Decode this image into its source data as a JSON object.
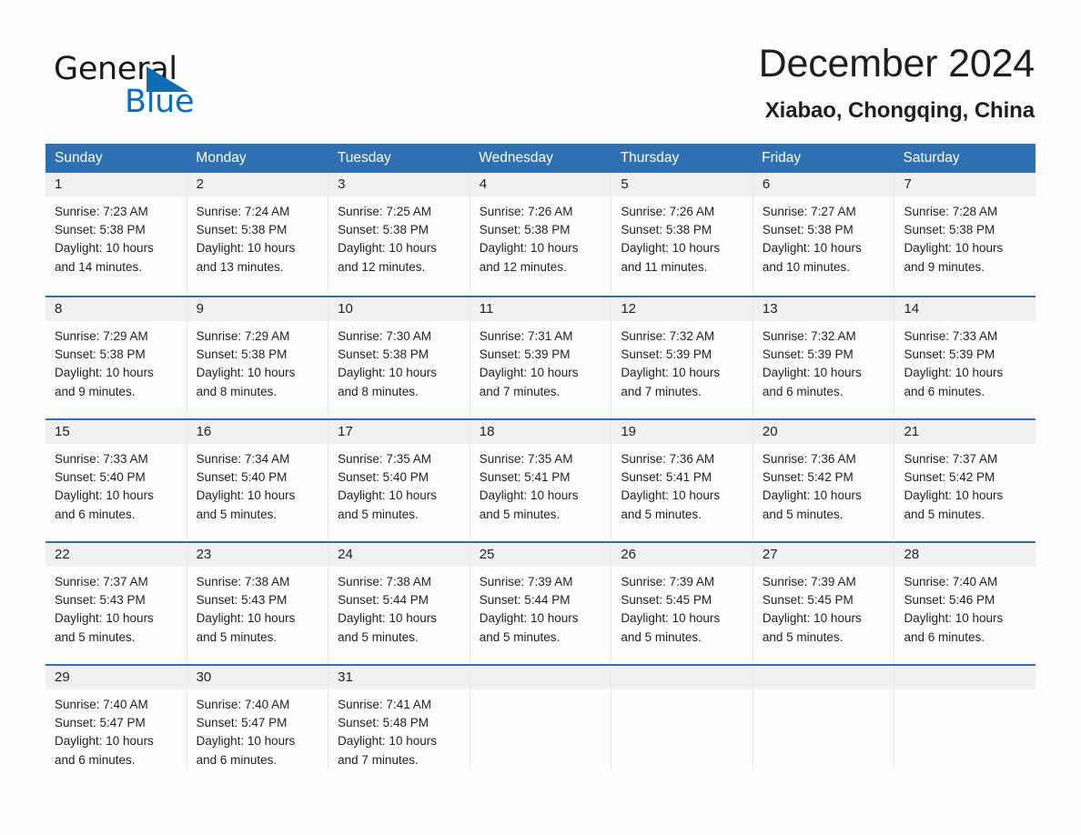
{
  "brand": {
    "name_part1": "General",
    "name_part2": "Blue"
  },
  "header": {
    "title": "December 2024",
    "location": "Xiabao, Chongqing, China"
  },
  "colors": {
    "header_blue": "#2e70b2",
    "brand_blue": "#0b6ec4",
    "daynum_band": "#f0f0f0",
    "text": "#1f1f1f"
  },
  "weekdays": [
    "Sunday",
    "Monday",
    "Tuesday",
    "Wednesday",
    "Thursday",
    "Friday",
    "Saturday"
  ],
  "weeks": [
    [
      {
        "day": "1",
        "lines": [
          "Sunrise: 7:23 AM",
          "Sunset: 5:38 PM",
          "Daylight: 10 hours",
          "and 14 minutes."
        ]
      },
      {
        "day": "2",
        "lines": [
          "Sunrise: 7:24 AM",
          "Sunset: 5:38 PM",
          "Daylight: 10 hours",
          "and 13 minutes."
        ]
      },
      {
        "day": "3",
        "lines": [
          "Sunrise: 7:25 AM",
          "Sunset: 5:38 PM",
          "Daylight: 10 hours",
          "and 12 minutes."
        ]
      },
      {
        "day": "4",
        "lines": [
          "Sunrise: 7:26 AM",
          "Sunset: 5:38 PM",
          "Daylight: 10 hours",
          "and 12 minutes."
        ]
      },
      {
        "day": "5",
        "lines": [
          "Sunrise: 7:26 AM",
          "Sunset: 5:38 PM",
          "Daylight: 10 hours",
          "and 11 minutes."
        ]
      },
      {
        "day": "6",
        "lines": [
          "Sunrise: 7:27 AM",
          "Sunset: 5:38 PM",
          "Daylight: 10 hours",
          "and 10 minutes."
        ]
      },
      {
        "day": "7",
        "lines": [
          "Sunrise: 7:28 AM",
          "Sunset: 5:38 PM",
          "Daylight: 10 hours",
          "and 9 minutes."
        ]
      }
    ],
    [
      {
        "day": "8",
        "lines": [
          "Sunrise: 7:29 AM",
          "Sunset: 5:38 PM",
          "Daylight: 10 hours",
          "and 9 minutes."
        ]
      },
      {
        "day": "9",
        "lines": [
          "Sunrise: 7:29 AM",
          "Sunset: 5:38 PM",
          "Daylight: 10 hours",
          "and 8 minutes."
        ]
      },
      {
        "day": "10",
        "lines": [
          "Sunrise: 7:30 AM",
          "Sunset: 5:38 PM",
          "Daylight: 10 hours",
          "and 8 minutes."
        ]
      },
      {
        "day": "11",
        "lines": [
          "Sunrise: 7:31 AM",
          "Sunset: 5:39 PM",
          "Daylight: 10 hours",
          "and 7 minutes."
        ]
      },
      {
        "day": "12",
        "lines": [
          "Sunrise: 7:32 AM",
          "Sunset: 5:39 PM",
          "Daylight: 10 hours",
          "and 7 minutes."
        ]
      },
      {
        "day": "13",
        "lines": [
          "Sunrise: 7:32 AM",
          "Sunset: 5:39 PM",
          "Daylight: 10 hours",
          "and 6 minutes."
        ]
      },
      {
        "day": "14",
        "lines": [
          "Sunrise: 7:33 AM",
          "Sunset: 5:39 PM",
          "Daylight: 10 hours",
          "and 6 minutes."
        ]
      }
    ],
    [
      {
        "day": "15",
        "lines": [
          "Sunrise: 7:33 AM",
          "Sunset: 5:40 PM",
          "Daylight: 10 hours",
          "and 6 minutes."
        ]
      },
      {
        "day": "16",
        "lines": [
          "Sunrise: 7:34 AM",
          "Sunset: 5:40 PM",
          "Daylight: 10 hours",
          "and 5 minutes."
        ]
      },
      {
        "day": "17",
        "lines": [
          "Sunrise: 7:35 AM",
          "Sunset: 5:40 PM",
          "Daylight: 10 hours",
          "and 5 minutes."
        ]
      },
      {
        "day": "18",
        "lines": [
          "Sunrise: 7:35 AM",
          "Sunset: 5:41 PM",
          "Daylight: 10 hours",
          "and 5 minutes."
        ]
      },
      {
        "day": "19",
        "lines": [
          "Sunrise: 7:36 AM",
          "Sunset: 5:41 PM",
          "Daylight: 10 hours",
          "and 5 minutes."
        ]
      },
      {
        "day": "20",
        "lines": [
          "Sunrise: 7:36 AM",
          "Sunset: 5:42 PM",
          "Daylight: 10 hours",
          "and 5 minutes."
        ]
      },
      {
        "day": "21",
        "lines": [
          "Sunrise: 7:37 AM",
          "Sunset: 5:42 PM",
          "Daylight: 10 hours",
          "and 5 minutes."
        ]
      }
    ],
    [
      {
        "day": "22",
        "lines": [
          "Sunrise: 7:37 AM",
          "Sunset: 5:43 PM",
          "Daylight: 10 hours",
          "and 5 minutes."
        ]
      },
      {
        "day": "23",
        "lines": [
          "Sunrise: 7:38 AM",
          "Sunset: 5:43 PM",
          "Daylight: 10 hours",
          "and 5 minutes."
        ]
      },
      {
        "day": "24",
        "lines": [
          "Sunrise: 7:38 AM",
          "Sunset: 5:44 PM",
          "Daylight: 10 hours",
          "and 5 minutes."
        ]
      },
      {
        "day": "25",
        "lines": [
          "Sunrise: 7:39 AM",
          "Sunset: 5:44 PM",
          "Daylight: 10 hours",
          "and 5 minutes."
        ]
      },
      {
        "day": "26",
        "lines": [
          "Sunrise: 7:39 AM",
          "Sunset: 5:45 PM",
          "Daylight: 10 hours",
          "and 5 minutes."
        ]
      },
      {
        "day": "27",
        "lines": [
          "Sunrise: 7:39 AM",
          "Sunset: 5:45 PM",
          "Daylight: 10 hours",
          "and 5 minutes."
        ]
      },
      {
        "day": "28",
        "lines": [
          "Sunrise: 7:40 AM",
          "Sunset: 5:46 PM",
          "Daylight: 10 hours",
          "and 6 minutes."
        ]
      }
    ],
    [
      {
        "day": "29",
        "lines": [
          "Sunrise: 7:40 AM",
          "Sunset: 5:47 PM",
          "Daylight: 10 hours",
          "and 6 minutes."
        ]
      },
      {
        "day": "30",
        "lines": [
          "Sunrise: 7:40 AM",
          "Sunset: 5:47 PM",
          "Daylight: 10 hours",
          "and 6 minutes."
        ]
      },
      {
        "day": "31",
        "lines": [
          "Sunrise: 7:41 AM",
          "Sunset: 5:48 PM",
          "Daylight: 10 hours",
          "and 7 minutes."
        ]
      },
      {
        "day": "",
        "lines": []
      },
      {
        "day": "",
        "lines": []
      },
      {
        "day": "",
        "lines": []
      },
      {
        "day": "",
        "lines": []
      }
    ]
  ]
}
